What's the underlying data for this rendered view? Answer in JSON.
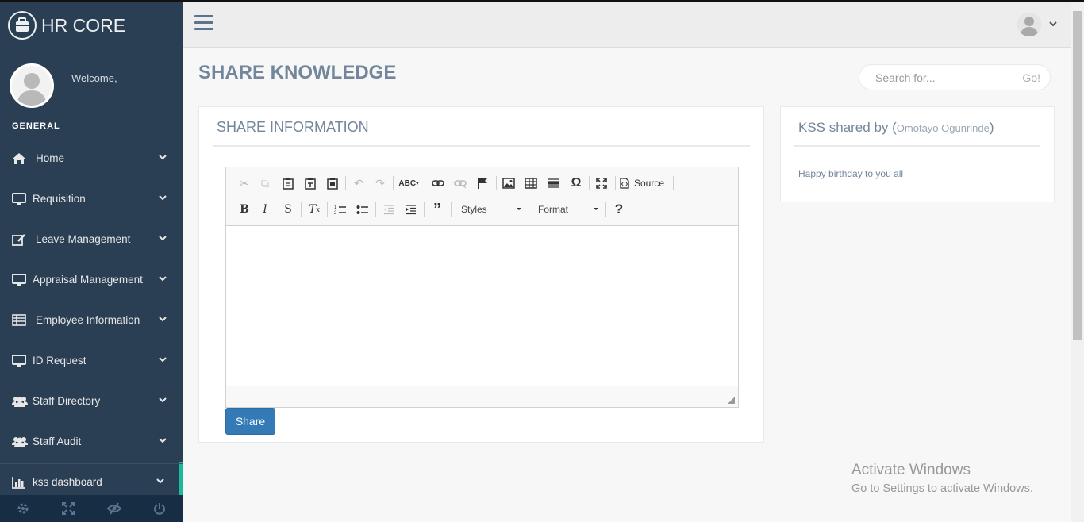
{
  "sidebar": {
    "brand": "HR CORE",
    "welcome": "Welcome,",
    "section": "GENERAL",
    "items": [
      {
        "label": "Home",
        "icon": "home-icon"
      },
      {
        "label": "Requisition",
        "icon": "desktop-icon"
      },
      {
        "label": "Leave Management",
        "icon": "edit-icon"
      },
      {
        "label": "Appraisal Management",
        "icon": "desktop-icon"
      },
      {
        "label": "Employee Information",
        "icon": "table-icon"
      },
      {
        "label": "ID Request",
        "icon": "desktop-icon"
      },
      {
        "label": "Staff Directory",
        "icon": "users-icon"
      },
      {
        "label": "Staff Audit",
        "icon": "users-icon"
      },
      {
        "label": "kss dashboard",
        "icon": "bar-chart-icon",
        "active": true
      }
    ],
    "footer_icons": [
      "settings-icon",
      "fullscreen-icon",
      "eye-slash-icon",
      "power-icon"
    ]
  },
  "header": {
    "page_title": "SHARE KNOWLEDGE"
  },
  "search": {
    "placeholder": "Search for...",
    "go_label": "Go!"
  },
  "share_panel": {
    "title": "SHARE INFORMATION",
    "toolbar": {
      "source_label": "Source",
      "styles_label": "Styles",
      "format_label": "Format",
      "help_label": "?"
    },
    "share_button": "Share"
  },
  "kss_panel": {
    "title_prefix": "KSS shared by (",
    "author": "Omotayo Ogunrinde",
    "title_suffix": ")",
    "message": "Happy birthday to you all"
  },
  "watermark": {
    "line1": "Activate Windows",
    "line2": "Go to Settings to activate Windows."
  },
  "colors": {
    "sidebar": "#2a3f54",
    "accent": "#1abb9c",
    "primary_button": "#337ab7"
  }
}
